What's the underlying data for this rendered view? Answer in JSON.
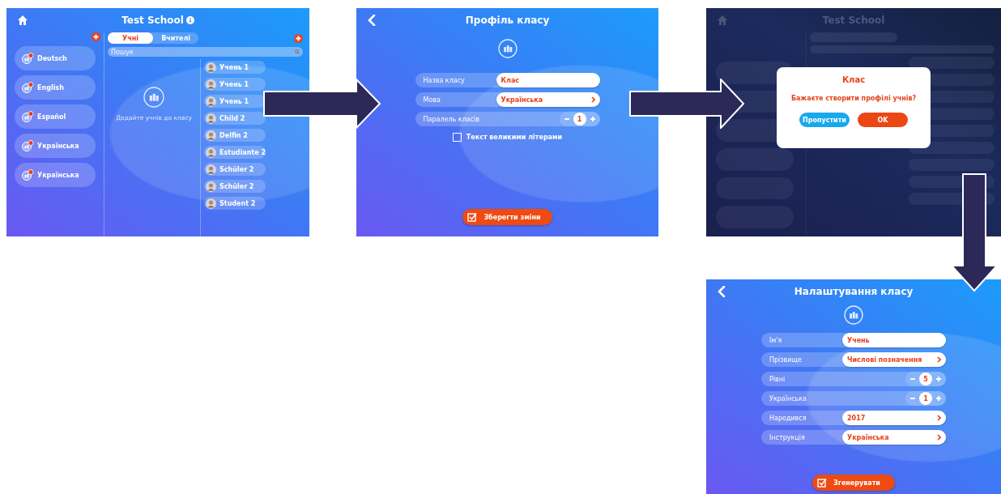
{
  "screens": [
    {
      "kind": "class_list",
      "title": "Test School",
      "tabs": [
        {
          "label": "Учні",
          "selected": true
        },
        {
          "label": "Вчителі",
          "selected": false
        }
      ],
      "search": {
        "placeholder": "Пошук"
      },
      "classes": [
        {
          "name": "Deutsch"
        },
        {
          "name": "English"
        },
        {
          "name": "Español"
        },
        {
          "name": "Українська"
        },
        {
          "name": "Українська"
        }
      ],
      "empty_hint": "Додайте учнів до класу",
      "students": [
        {
          "name": "Учень 1"
        },
        {
          "name": "Учень 1"
        },
        {
          "name": "Учень 1"
        },
        {
          "name": "Child 2"
        },
        {
          "name": "Delfin 2"
        },
        {
          "name": "Estudiante 2"
        },
        {
          "name": "Schüler 2"
        },
        {
          "name": "Schüler 2"
        },
        {
          "name": "Student 2"
        }
      ]
    },
    {
      "kind": "form",
      "title": "Профіль класу",
      "fields": [
        {
          "kind": "text",
          "label": "Назва класу",
          "value": "Клас"
        },
        {
          "kind": "select",
          "label": "Мова",
          "value": "Українська"
        },
        {
          "kind": "stepper",
          "label": "Паралель класів",
          "value": "1"
        }
      ],
      "checkbox": {
        "label": "Текст великими літерами",
        "checked": false
      },
      "action": "Зберегти зміни"
    },
    {
      "kind": "dialog_overlay",
      "title": "Test School",
      "dialog": {
        "title": "Клас",
        "message": "Бажаєте створити профілі учнів?",
        "buttons": [
          {
            "kind": "secondary",
            "label": "Пропустити"
          },
          {
            "kind": "primary",
            "label": "OK"
          }
        ]
      }
    },
    {
      "kind": "form",
      "title": "Налаштування класу",
      "fields": [
        {
          "kind": "text",
          "label": "Ім'я",
          "value": "Учень"
        },
        {
          "kind": "select",
          "label": "Прізвище",
          "value": "Числові позначення"
        },
        {
          "kind": "stepper",
          "label": "Рівні",
          "value": "5"
        },
        {
          "kind": "stepper",
          "label": "Українська",
          "value": "1"
        },
        {
          "kind": "select",
          "label": "Народився",
          "value": "2017"
        },
        {
          "kind": "select",
          "label": "Інструкція",
          "value": "Українська"
        }
      ],
      "action": "Згенерувати"
    }
  ]
}
